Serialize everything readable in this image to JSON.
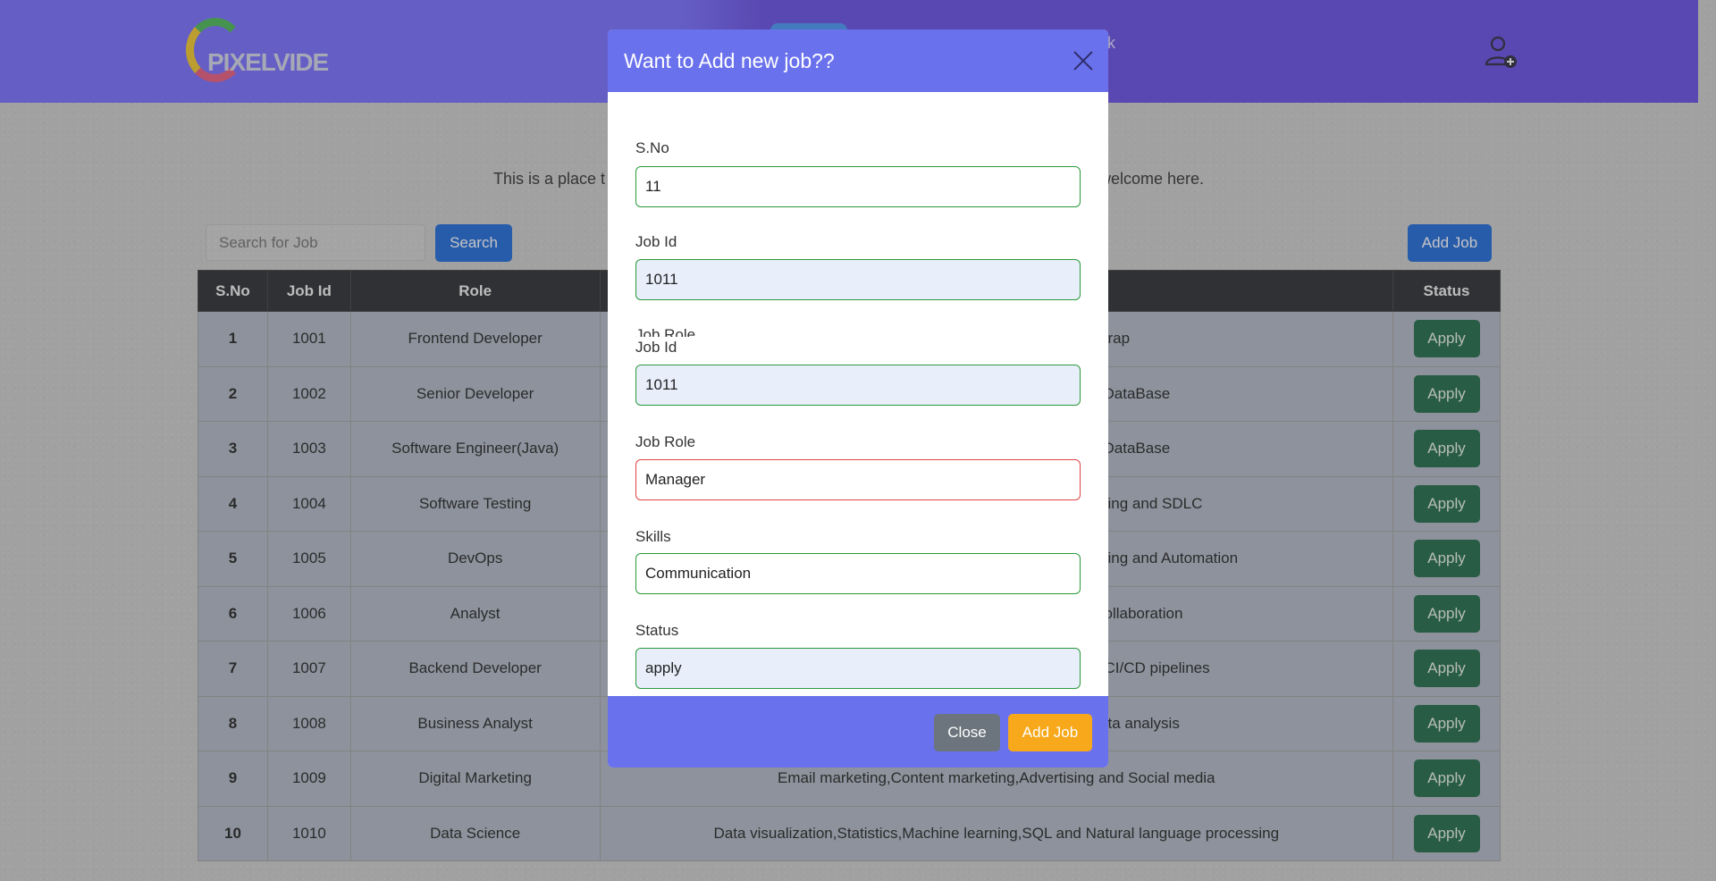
{
  "navbar": {
    "logo_text": "PIXELVIDE",
    "feedback_partial": "ack"
  },
  "intro": {
    "start_partial": "This is a place t",
    "end_partial": "welcome here."
  },
  "search": {
    "placeholder": "Search for Job",
    "button_label": "Search"
  },
  "add_job_button": "Add Job",
  "table": {
    "headers": [
      "S.No",
      "Job Id",
      "Role",
      "",
      "Status"
    ],
    "rows": [
      {
        "sno": "1",
        "job_id": "1001",
        "role": "Frontend Developer",
        "skills": "rap",
        "status": "Apply"
      },
      {
        "sno": "2",
        "job_id": "1002",
        "role": "Senior Developer",
        "skills": "DataBase",
        "status": "Apply"
      },
      {
        "sno": "3",
        "job_id": "1003",
        "role": "Software Engineer(Java)",
        "skills": "DataBase",
        "status": "Apply"
      },
      {
        "sno": "4",
        "job_id": "1004",
        "role": "Software Testing",
        "skills": "ing and SDLC",
        "status": "Apply"
      },
      {
        "sno": "5",
        "job_id": "1005",
        "role": "DevOps",
        "skills": "ing and Automation",
        "status": "Apply"
      },
      {
        "sno": "6",
        "job_id": "1006",
        "role": "Analyst",
        "skills": "ollaboration",
        "status": "Apply"
      },
      {
        "sno": "7",
        "job_id": "1007",
        "role": "Backend Developer",
        "skills": "CI/CD pipelines",
        "status": "Apply"
      },
      {
        "sno": "8",
        "job_id": "1008",
        "role": "Business Analyst",
        "skills": "ta analysis",
        "status": "Apply"
      },
      {
        "sno": "9",
        "job_id": "1009",
        "role": "Digital Marketing",
        "skills": "Email marketing,Content marketing,Advertising and Social media",
        "status": "Apply"
      },
      {
        "sno": "10",
        "job_id": "1010",
        "role": "Data Science",
        "skills": "Data visualization,Statistics,Machine learning,SQL and Natural language processing",
        "status": "Apply"
      }
    ]
  },
  "modal": {
    "title": "Want to Add new job??",
    "fields": {
      "sno": {
        "label": "S.No",
        "value": "11"
      },
      "job_id": {
        "label": "Job Id",
        "value": "1011"
      },
      "clipped_label": "Job Role",
      "job_id_2": {
        "label": "Job Id",
        "value": "1011"
      },
      "job_role": {
        "label": "Job Role",
        "value": "Manager"
      },
      "skills": {
        "label": "Skills",
        "value": "Communication"
      },
      "status": {
        "label": "Status",
        "value": "apply"
      }
    },
    "close_label": "Close",
    "add_label": "Add Job"
  },
  "colors": {
    "navbar": "#6c63ff",
    "modal_header": "#6a71ec",
    "apply_button": "#0f5e3a",
    "add_job_yellow": "#f7a91b",
    "primary_blue": "#0d5ed8",
    "valid_border": "#2a9a3a",
    "invalid_border": "#e04444"
  }
}
